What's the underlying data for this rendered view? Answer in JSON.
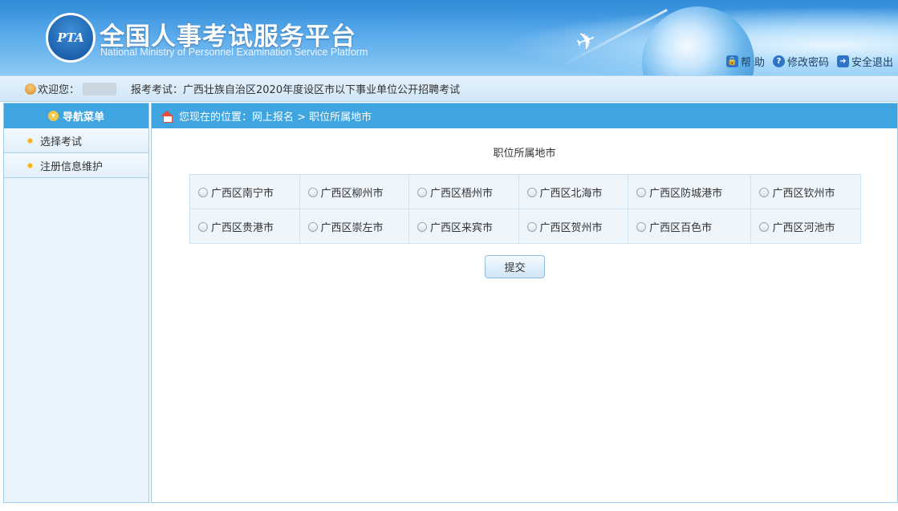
{
  "header": {
    "logo_text": "PTA",
    "title": "全国人事考试服务平台",
    "subtitle": "National Ministry of Personnel Examination Service Platform",
    "links": [
      {
        "label": "帮 助",
        "icon": "help-icon"
      },
      {
        "label": "修改密码",
        "icon": "key-icon"
      },
      {
        "label": "安全退出",
        "icon": "logout-icon"
      }
    ]
  },
  "welcome": {
    "greeting": "欢迎您：",
    "exam_label": "报考考试：广西壮族自治区2020年度设区市以下事业单位公开招聘考试"
  },
  "sidebar": {
    "title": "导航菜单",
    "items": [
      {
        "label": "选择考试"
      },
      {
        "label": "注册信息维护"
      }
    ]
  },
  "breadcrumb": {
    "text": "您现在的位置：网上报名  >  职位所属地市"
  },
  "main": {
    "page_title": "职位所属地市",
    "cities": [
      [
        "广西区南宁市",
        "广西区柳州市",
        "广西区梧州市",
        "广西区北海市",
        "广西区防城港市",
        "广西区钦州市"
      ],
      [
        "广西区贵港市",
        "广西区崇左市",
        "广西区来宾市",
        "广西区贺州市",
        "广西区百色市",
        "广西区河池市"
      ]
    ],
    "submit_label": "提交"
  }
}
